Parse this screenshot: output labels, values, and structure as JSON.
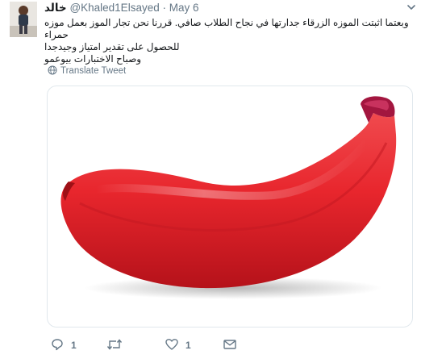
{
  "tweet": {
    "display_name": "خالد",
    "handle": "@Khaled1Elsayed",
    "separator": "·",
    "date": "May 6",
    "text_lines": [
      "وبعتما اثبتت الموزه الزرقاء جدارتها في نجاح الطلاب صافي. قررنا نحن تجار الموز بعمل موزه حمراء",
      "للحصول على تقدير امتياز وجيدجدا",
      "وصباح الاختبارات بيوعمو"
    ],
    "translate_label": "Translate Tweet",
    "reply_count": "1",
    "like_count": "1"
  },
  "icons": {
    "avatar": "profile-photo",
    "caret": "chevron-down-icon",
    "translate": "globe-icon",
    "reply": "reply-icon",
    "retweet": "retweet-icon",
    "like": "heart-icon",
    "dm": "envelope-icon"
  },
  "colors": {
    "text": "#14171a",
    "secondary": "#657786",
    "border": "#e1e8ed",
    "banana": "#e8262d"
  }
}
